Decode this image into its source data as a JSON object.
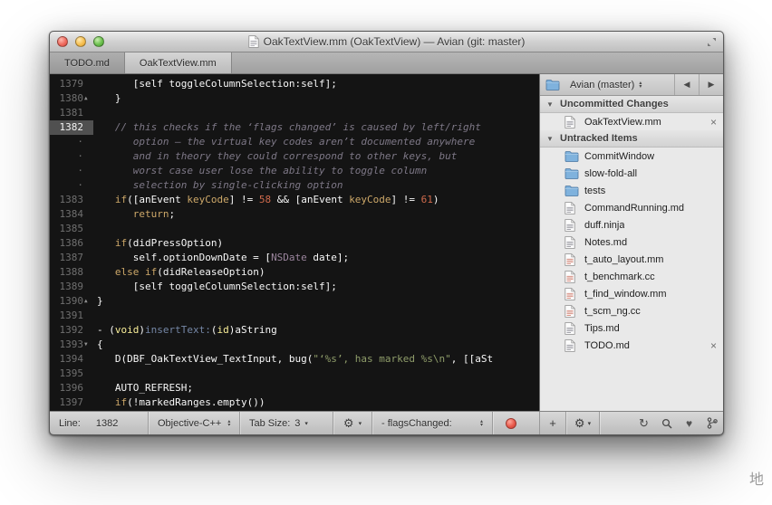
{
  "window": {
    "title": "OakTextView.mm (OakTextView) — Avian (git: master)"
  },
  "tabs": [
    {
      "label": "TODO.md",
      "active": false
    },
    {
      "label": "OakTextView.mm",
      "active": true
    }
  ],
  "editor": {
    "current_line": "1382",
    "rows": [
      {
        "n": "1379",
        "tokens": [
          {
            "t": "      [self toggleColumnSelection:self];",
            "c": "p"
          }
        ]
      },
      {
        "n": "1380",
        "marker": "up",
        "tokens": [
          {
            "t": "   }",
            "c": "p"
          }
        ]
      },
      {
        "n": "1381",
        "tokens": []
      },
      {
        "n": "1382",
        "current": true,
        "tokens": [
          {
            "t": "   // this checks if the ‘flags changed’ is caused by left/right",
            "c": "c"
          }
        ]
      },
      {
        "n": "·",
        "tokens": [
          {
            "t": "      option — the virtual key codes aren’t documented anywhere",
            "c": "c"
          }
        ]
      },
      {
        "n": "·",
        "tokens": [
          {
            "t": "      and in theory they could correspond to other keys, but",
            "c": "c"
          }
        ]
      },
      {
        "n": "·",
        "tokens": [
          {
            "t": "      worst case user lose the ability to toggle column",
            "c": "c"
          }
        ]
      },
      {
        "n": "·",
        "tokens": [
          {
            "t": "      selection by single-clicking option",
            "c": "c"
          }
        ]
      },
      {
        "n": "1383",
        "tokens": [
          {
            "t": "   ",
            "c": "p"
          },
          {
            "t": "if",
            "c": "k"
          },
          {
            "t": "([anEvent ",
            "c": "p"
          },
          {
            "t": "keyCode",
            "c": "k"
          },
          {
            "t": "] != ",
            "c": "p"
          },
          {
            "t": "58",
            "c": "n"
          },
          {
            "t": " && [anEvent ",
            "c": "p"
          },
          {
            "t": "keyCode",
            "c": "k"
          },
          {
            "t": "] != ",
            "c": "p"
          },
          {
            "t": "61",
            "c": "n"
          },
          {
            "t": ")",
            "c": "p"
          }
        ]
      },
      {
        "n": "1384",
        "tokens": [
          {
            "t": "      ",
            "c": "p"
          },
          {
            "t": "return",
            "c": "k"
          },
          {
            "t": ";",
            "c": "p"
          }
        ]
      },
      {
        "n": "1385",
        "tokens": []
      },
      {
        "n": "1386",
        "tokens": [
          {
            "t": "   ",
            "c": "p"
          },
          {
            "t": "if",
            "c": "k"
          },
          {
            "t": "(didPressOption)",
            "c": "p"
          }
        ]
      },
      {
        "n": "1387",
        "tokens": [
          {
            "t": "      self.optionDownDate = [",
            "c": "p"
          },
          {
            "t": "NSDate",
            "c": "t"
          },
          {
            "t": " date];",
            "c": "p"
          }
        ]
      },
      {
        "n": "1388",
        "tokens": [
          {
            "t": "   ",
            "c": "p"
          },
          {
            "t": "else",
            "c": "k"
          },
          {
            "t": " ",
            "c": "p"
          },
          {
            "t": "if",
            "c": "k"
          },
          {
            "t": "(didReleaseOption)",
            "c": "p"
          }
        ]
      },
      {
        "n": "1389",
        "tokens": [
          {
            "t": "      [self toggleColumnSelection:self];",
            "c": "p"
          }
        ]
      },
      {
        "n": "1390",
        "marker": "up",
        "tokens": [
          {
            "t": "}",
            "c": "p"
          }
        ]
      },
      {
        "n": "1391",
        "tokens": []
      },
      {
        "n": "1392",
        "tokens": [
          {
            "t": "- (",
            "c": "p"
          },
          {
            "t": "void",
            "c": "y"
          },
          {
            "t": ")",
            "c": "p"
          },
          {
            "t": "insertText:",
            "c": "f"
          },
          {
            "t": "(",
            "c": "p"
          },
          {
            "t": "id",
            "c": "y"
          },
          {
            "t": ")aString",
            "c": "p"
          }
        ]
      },
      {
        "n": "1393",
        "marker": "down",
        "tokens": [
          {
            "t": "{",
            "c": "p"
          }
        ]
      },
      {
        "n": "1394",
        "tokens": [
          {
            "t": "   D(DBF_OakTextView_TextInput, bug(",
            "c": "p"
          },
          {
            "t": "\"‘%s’, has marked %s\\n\"",
            "c": "s"
          },
          {
            "t": ", [[aSt",
            "c": "p"
          }
        ]
      },
      {
        "n": "1395",
        "tokens": []
      },
      {
        "n": "1396",
        "tokens": [
          {
            "t": "   AUTO_REFRESH;",
            "c": "p"
          }
        ]
      },
      {
        "n": "1397",
        "tokens": [
          {
            "t": "   ",
            "c": "p"
          },
          {
            "t": "if",
            "c": "k"
          },
          {
            "t": "(!markedRanges.empty())",
            "c": "p"
          }
        ]
      }
    ]
  },
  "file_browser": {
    "header": {
      "title": "Avian (master)"
    },
    "items": [
      {
        "kind": "section",
        "label": "Uncommitted Changes"
      },
      {
        "kind": "file",
        "icon": "doc",
        "label": "OakTextView.mm",
        "closable": true,
        "tint": "#8f8f98"
      },
      {
        "kind": "section",
        "label": "Untracked Items"
      },
      {
        "kind": "file",
        "icon": "folder",
        "label": "CommitWindow"
      },
      {
        "kind": "file",
        "icon": "folder",
        "label": "slow-fold-all"
      },
      {
        "kind": "file",
        "icon": "folder",
        "label": "tests"
      },
      {
        "kind": "file",
        "icon": "doc",
        "label": "CommandRunning.md",
        "tint": "#8f8f98"
      },
      {
        "kind": "file",
        "icon": "doc",
        "label": "duff.ninja",
        "tint": "#8f8f98"
      },
      {
        "kind": "file",
        "icon": "doc",
        "label": "Notes.md",
        "tint": "#8f8f98"
      },
      {
        "kind": "file",
        "icon": "doc",
        "label": "t_auto_layout.mm",
        "tint": "#cf7a6a"
      },
      {
        "kind": "file",
        "icon": "doc",
        "label": "t_benchmark.cc",
        "tint": "#cf7a6a"
      },
      {
        "kind": "file",
        "icon": "doc",
        "label": "t_find_window.mm",
        "tint": "#cf7a6a"
      },
      {
        "kind": "file",
        "icon": "doc",
        "label": "t_scm_ng.cc",
        "tint": "#cf7a6a"
      },
      {
        "kind": "file",
        "icon": "doc",
        "label": "Tips.md",
        "tint": "#8f8f98"
      },
      {
        "kind": "file",
        "icon": "doc",
        "label": "TODO.md",
        "closable": true,
        "tint": "#8f8f98"
      }
    ]
  },
  "status_bar": {
    "line_label": "Line:",
    "line_value": "1382",
    "language": "Objective-C++",
    "tab_size_label": "Tab Size:",
    "tab_size_value": "3",
    "symbol": "- flagsChanged:",
    "plus_label": "+"
  },
  "icons": {
    "back": "◀",
    "forward": "▶",
    "popup_up": "▴",
    "popup_down": "▾",
    "gear": "⚙",
    "plus": "+",
    "refresh": "↻",
    "heart": "♥",
    "close": "×",
    "disclosure": "▼",
    "fold_up": "▲",
    "fold_down": "▼"
  },
  "background_text": "地"
}
